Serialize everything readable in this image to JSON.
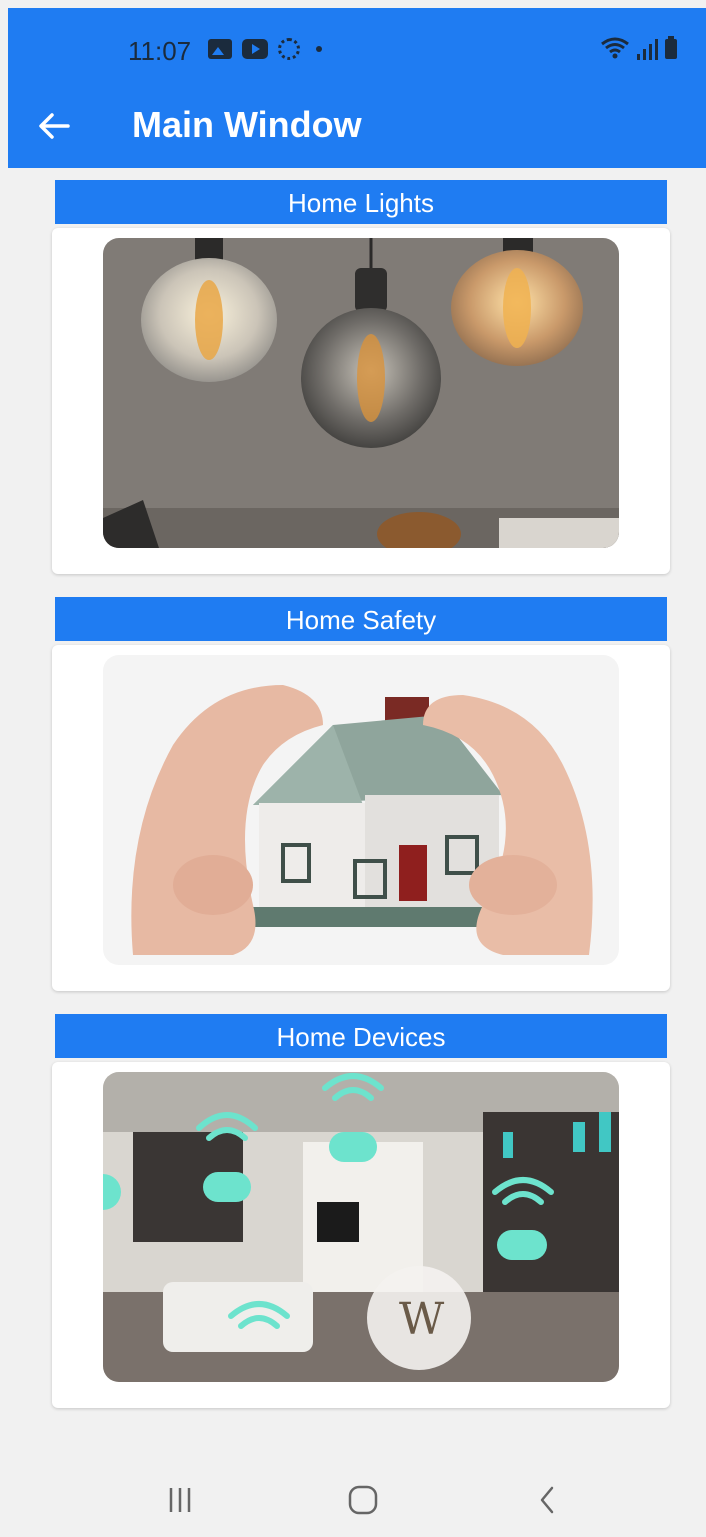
{
  "status_bar": {
    "time": "11:07",
    "icons": [
      "gallery-icon",
      "youtube-icon",
      "settings-gear-icon",
      "notification-dot-icon",
      "wifi-icon",
      "signal-icon",
      "battery-icon"
    ]
  },
  "toolbar": {
    "title": "Main Window",
    "back_icon": "arrow-left-icon"
  },
  "sections": [
    {
      "title": "Home Lights",
      "image": "pendant-lights-photo"
    },
    {
      "title": "Home Safety",
      "image": "hands-protecting-house-photo"
    },
    {
      "title": "Home Devices",
      "image": "smart-living-room-photo"
    }
  ],
  "colors": {
    "primary": "#1f7cf2",
    "background": "#f1f1f1",
    "card": "#ffffff",
    "status_icons": "#1b2b3d"
  },
  "nav_bar": {
    "icons": [
      "recent-apps-icon",
      "home-icon",
      "back-icon"
    ]
  }
}
